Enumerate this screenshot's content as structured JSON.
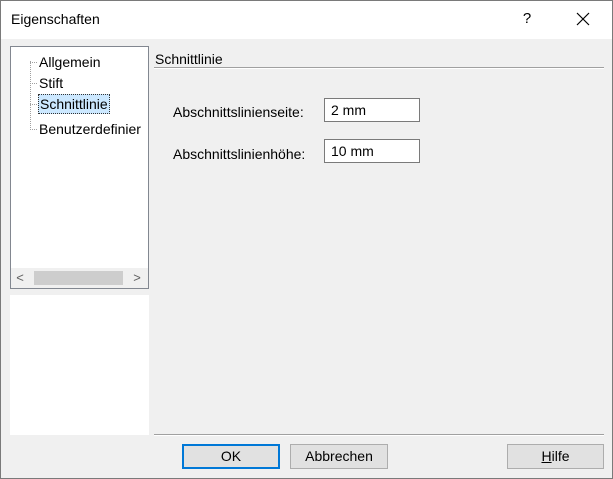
{
  "window": {
    "title": "Eigenschaften",
    "help_label": "?"
  },
  "tree": {
    "items": [
      {
        "label": "Allgemein"
      },
      {
        "label": "Stift"
      },
      {
        "label": "Schnittlinie",
        "selected": true
      },
      {
        "label": "Benutzerdefinier"
      }
    ],
    "scroll_left": "<",
    "scroll_right": ">"
  },
  "section": {
    "title": "Schnittlinie"
  },
  "fields": {
    "side_label": "Abschnittslinienseite:",
    "side_value": "2 mm",
    "height_label": "Abschnittslinienhöhe:",
    "height_value": "10 mm"
  },
  "buttons": {
    "ok": "OK",
    "cancel": "Abbrechen",
    "help_first": "H",
    "help_rest": "ilfe"
  },
  "colors": {
    "selection": "#cce8ff",
    "default_button_border": "#0078d7",
    "button_face": "#e1e1e1",
    "dialog_bg": "#f0f0f0"
  }
}
